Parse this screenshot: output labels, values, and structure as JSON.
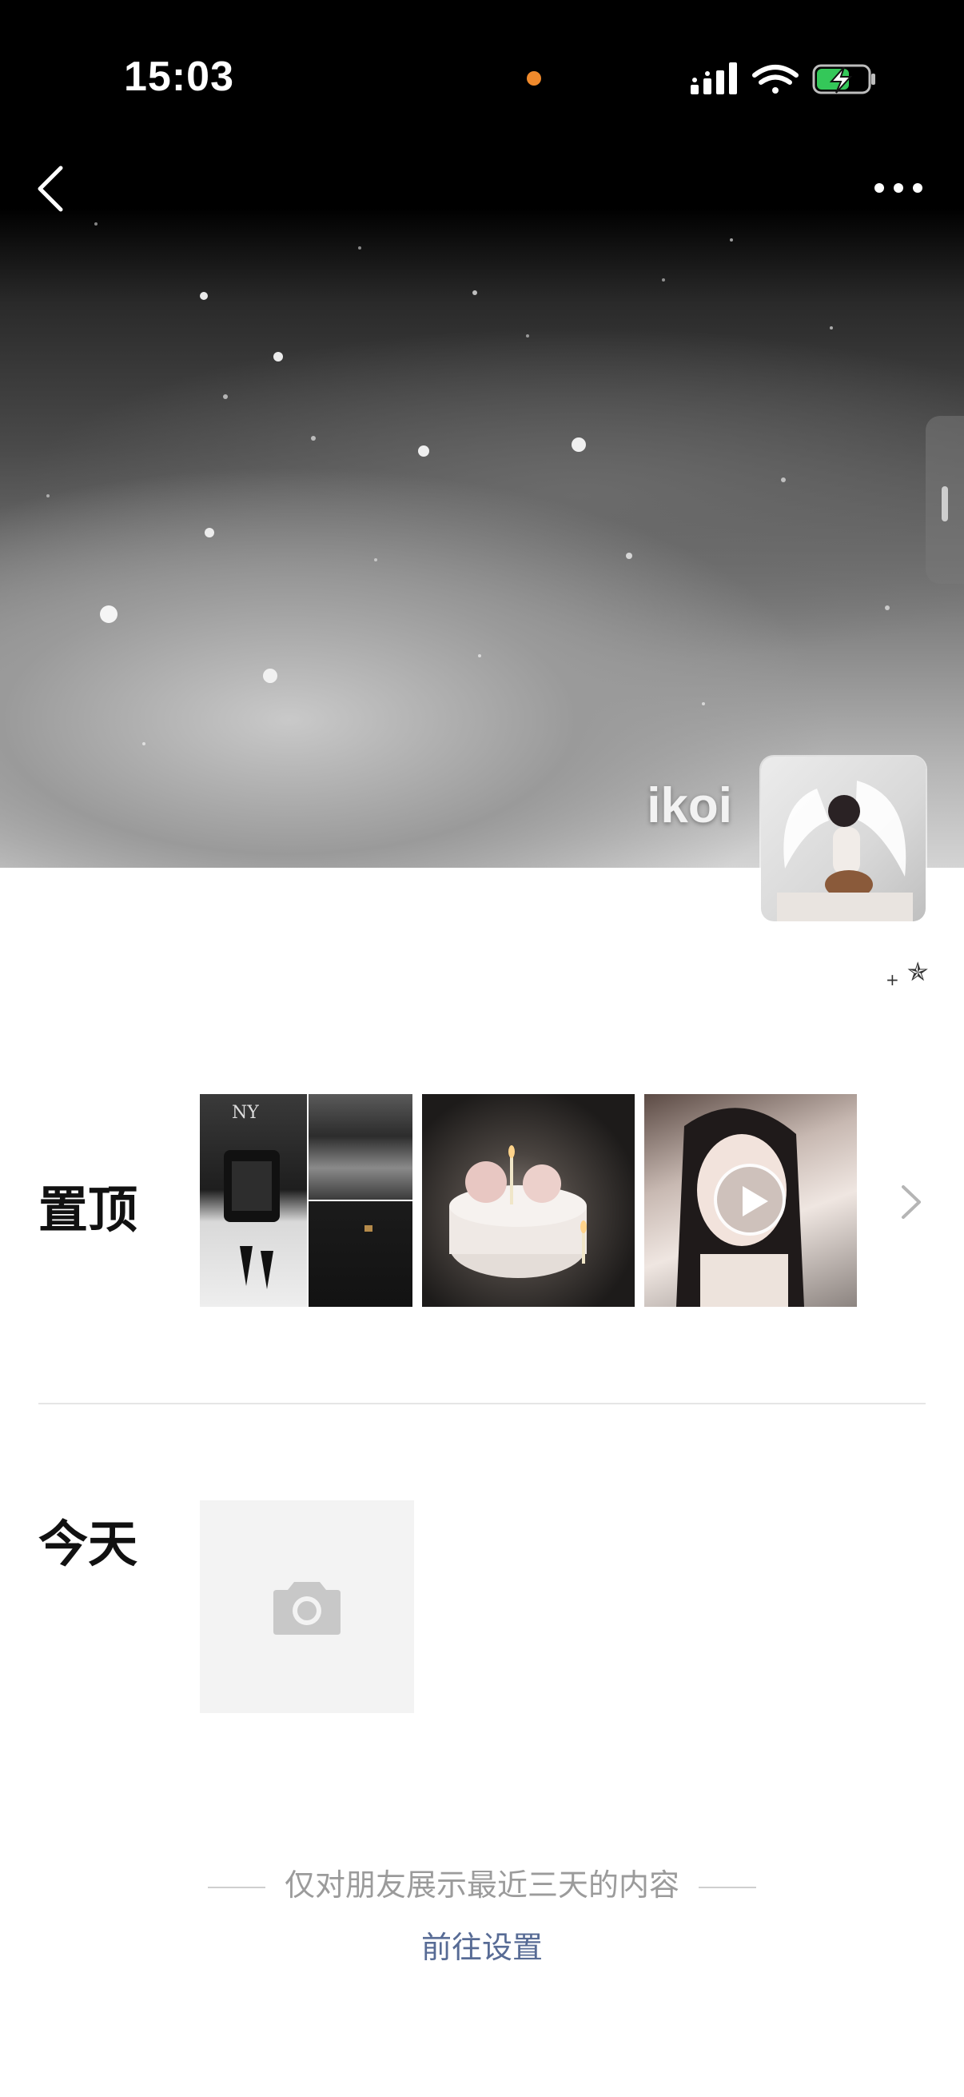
{
  "status_bar": {
    "time": "15:03",
    "recording_indicator_color": "#f08a2c",
    "icons": [
      "signal-icon",
      "wifi-icon",
      "battery-charging-icon"
    ]
  },
  "nav": {
    "back_icon": "chevron-left-icon",
    "more_icon": "more-horizontal-icon"
  },
  "profile": {
    "username": "ikoi",
    "signature_plus": "+",
    "signature_star": "✯"
  },
  "pinned": {
    "label": "置顶",
    "thumbnails": [
      "photo",
      "photo",
      "photo",
      "photo",
      "video"
    ],
    "more_icon": "chevron-right-icon"
  },
  "today": {
    "label": "今天",
    "add_icon": "camera-icon"
  },
  "footer": {
    "note": "仅对朋友展示最近三天的内容",
    "link": "前往设置"
  },
  "colors": {
    "link": "#576b95",
    "note_text": "#9b9b9b",
    "charging_green": "#34c759"
  }
}
